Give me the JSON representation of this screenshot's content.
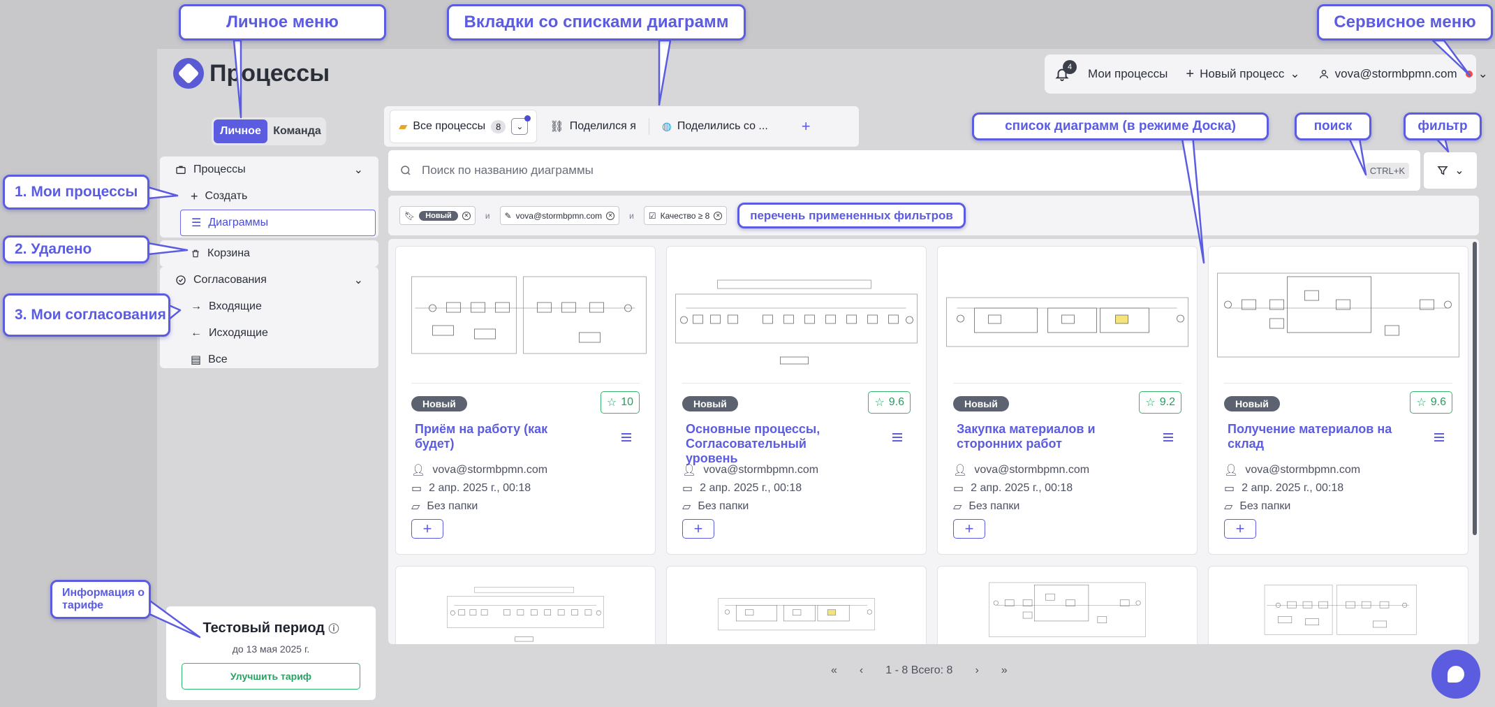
{
  "app": {
    "title": "Процессы"
  },
  "topbar": {
    "notifications_count": "4",
    "my_processes": "Мои процессы",
    "new_process": "Новый процесс",
    "user_email": "vova@stormbpmn.com"
  },
  "sidebar": {
    "segment": {
      "personal": "Личное",
      "team": "Команда",
      "active": "personal"
    },
    "processes": {
      "label": "Процессы",
      "create": "Создать",
      "diagrams": "Диаграммы"
    },
    "trash": "Корзина",
    "approvals": {
      "label": "Согласования",
      "incoming": "Входящие",
      "outgoing": "Исходящие",
      "all": "Все"
    }
  },
  "tariff": {
    "title": "Тестовый период",
    "until": "до 13 мая 2025 г.",
    "upgrade": "Улучшить тариф"
  },
  "tabs": {
    "all": {
      "label": "Все процессы",
      "count": "8"
    },
    "shared_by_me": "Поделился я",
    "shared_with_me": "Поделились со ...",
    "add": "+"
  },
  "search": {
    "placeholder": "Поиск по названию диаграммы",
    "shortcut": "CTRL+K"
  },
  "applied_filters": {
    "status": "Новый",
    "author": "vova@stormbpmn.com",
    "quality": "Качество ≥ 8",
    "and": "и"
  },
  "cards": [
    {
      "status": "Новый",
      "rating": "10",
      "title": "Приём на работу (как будет)",
      "author": "vova@stormbpmn.com",
      "date": "2 апр. 2025 г., 00:18",
      "folder": "Без папки"
    },
    {
      "status": "Новый",
      "rating": "9.6",
      "title": "Основные процессы, Согласовательный уровень",
      "author": "vova@stormbpmn.com",
      "date": "2 апр. 2025 г., 00:18",
      "folder": "Без папки"
    },
    {
      "status": "Новый",
      "rating": "9.2",
      "title": "Закупка материалов и сторонних работ",
      "author": "vova@stormbpmn.com",
      "date": "2 апр. 2025 г., 00:18",
      "folder": "Без папки"
    },
    {
      "status": "Новый",
      "rating": "9.6",
      "title": "Получение материалов на склад",
      "author": "vova@stormbpmn.com",
      "date": "2 апр. 2025 г., 00:18",
      "folder": "Без папки"
    }
  ],
  "pagination": {
    "summary": "1 - 8 Всего: 8"
  },
  "annotations": {
    "personal_menu": "Личное меню",
    "tabs": "Вкладки со списками диаграмм",
    "service_menu": "Сервисное меню",
    "my_processes": "1. Мои процессы",
    "deleted": "2. Удалено",
    "my_approvals": "3. Мои согласования",
    "board": "список диаграмм (в режиме Доска)",
    "search": "поиск",
    "filter": "фильтр",
    "applied_filters": "перечень примененных фильтров",
    "tariff_info": "Информация о тарифе"
  },
  "colors": {
    "accent": "#5b5ce0",
    "success": "#2cb56b",
    "badge": "#5d6270",
    "alert": "#f04a4a"
  }
}
